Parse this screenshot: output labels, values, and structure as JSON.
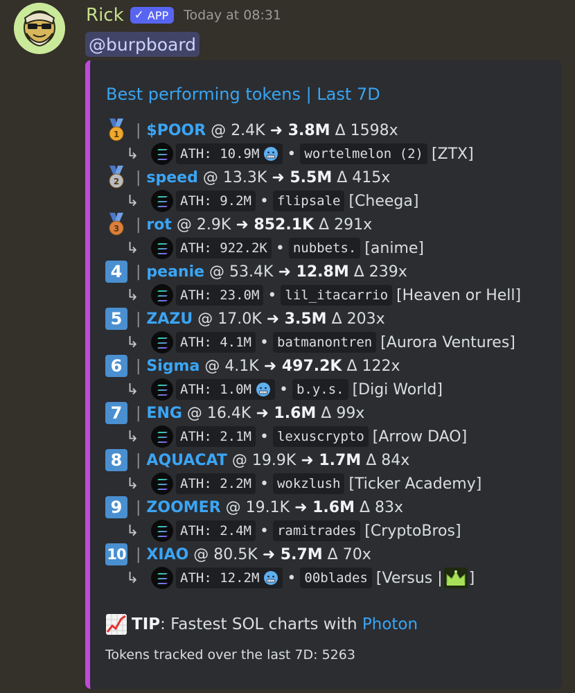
{
  "message": {
    "username": "Rick",
    "app_badge": "APP",
    "timestamp": "Today at 08:31",
    "mention": "@burpboard"
  },
  "embed": {
    "title": "Best performing tokens | Last 7D",
    "accent_color": "#c04ad9",
    "entries": [
      {
        "rank": "1",
        "rank_style": "gold-medal",
        "token": "$POOR",
        "from": "@ 2.4K",
        "to": "3.8M",
        "delta": "Δ 1598x",
        "ath": "ATH: 10.9M",
        "frozen": true,
        "caller": "wortelmelon (2)",
        "group": "[ZTX]"
      },
      {
        "rank": "2",
        "rank_style": "silver-medal",
        "token": "speed",
        "from": "@ 13.3K",
        "to": "5.5M",
        "delta": "Δ 415x",
        "ath": "ATH: 9.2M",
        "frozen": false,
        "caller": "flipsale",
        "group": "[Cheega]"
      },
      {
        "rank": "3",
        "rank_style": "bronze-medal",
        "token": "rot",
        "from": "@ 2.9K",
        "to": "852.1K",
        "delta": "Δ 291x",
        "ath": "ATH: 922.2K",
        "frozen": false,
        "caller": "nubbets.",
        "group": "[anime]"
      },
      {
        "rank": "4",
        "rank_style": "number-box",
        "token": "peanie",
        "from": "@ 53.4K",
        "to": "12.8M",
        "delta": "Δ 239x",
        "ath": "ATH: 23.0M",
        "frozen": false,
        "caller": "lil_itacarrio",
        "group": "[Heaven or Hell]"
      },
      {
        "rank": "5",
        "rank_style": "number-box",
        "token": "ZAZU",
        "from": "@ 17.0K",
        "to": "3.5M",
        "delta": "Δ 203x",
        "ath": "ATH: 4.1M",
        "frozen": false,
        "caller": "batmanontren",
        "group": "[Aurora Ventures]"
      },
      {
        "rank": "6",
        "rank_style": "number-box",
        "token": "Sigma",
        "from": "@ 4.1K",
        "to": "497.2K",
        "delta": "Δ 122x",
        "ath": "ATH: 1.0M",
        "frozen": true,
        "caller": "b.y.s.",
        "group": "[Digi World]"
      },
      {
        "rank": "7",
        "rank_style": "number-box",
        "token": "ENG",
        "from": "@ 16.4K",
        "to": "1.6M",
        "delta": "Δ 99x",
        "ath": "ATH: 2.1M",
        "frozen": false,
        "caller": "lexuscrypto",
        "group": "[Arrow DAO]"
      },
      {
        "rank": "8",
        "rank_style": "number-box",
        "token": "AQUACAT",
        "from": "@ 19.9K",
        "to": "1.7M",
        "delta": "Δ 84x",
        "ath": "ATH: 2.2M",
        "frozen": false,
        "caller": "wokzlush",
        "group": "[Ticker Academy]"
      },
      {
        "rank": "9",
        "rank_style": "number-box",
        "token": "ZOOMER",
        "from": "@ 19.1K",
        "to": "1.6M",
        "delta": "Δ 83x",
        "ath": "ATH: 2.4M",
        "frozen": false,
        "caller": "ramitrades",
        "group": "[CryptoBros]"
      },
      {
        "rank": "10",
        "rank_style": "number-box",
        "token": "XIAO",
        "from": "@ 80.5K",
        "to": "5.7M",
        "delta": "Δ 70x",
        "ath": "ATH: 12.2M",
        "frozen": true,
        "caller": "00blades",
        "group_prefix": "[Versus |",
        "group_suffix": "]",
        "group_icon": "crown-emoji"
      }
    ],
    "arrow": "➜",
    "hook": "↳",
    "bullet": "•",
    "tip": {
      "icon": "chart-increasing-emoji",
      "label": "TIP",
      "text": ": Fastest SOL charts with ",
      "link": "Photon"
    },
    "footer": "Tokens tracked over the last 7D: 5263"
  },
  "colors": {
    "background": "#34302a",
    "embed_bg": "#2b2d31",
    "link": "#3ba5f5",
    "username": "#c6e08c",
    "badge": "#5865f2"
  }
}
